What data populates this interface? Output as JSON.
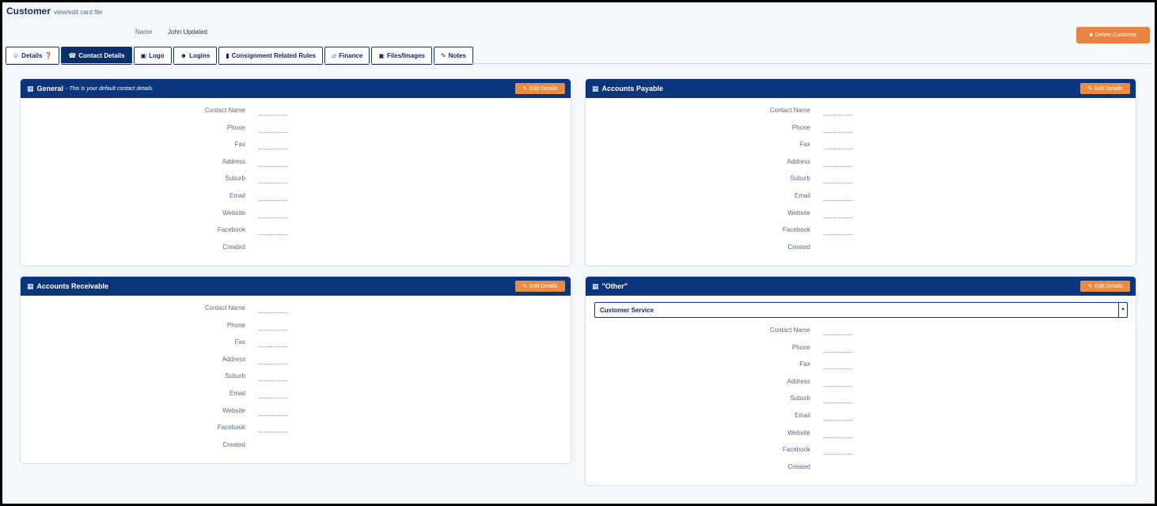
{
  "header": {
    "title": "Customer",
    "subtitle": "view/edit card file",
    "name_label": "Name",
    "name_value": "John Updated",
    "delete_label": "Delete Customer"
  },
  "tabs": [
    {
      "label": "Details",
      "icon": "user-icon",
      "glyph": "☺"
    },
    {
      "label": "Contact Details",
      "icon": "phone-icon",
      "glyph": "☎"
    },
    {
      "label": "Logo",
      "icon": "image-icon",
      "glyph": "▣"
    },
    {
      "label": "Logins",
      "icon": "users-icon",
      "glyph": "☻"
    },
    {
      "label": "Consignment Related Rules",
      "icon": "file-icon",
      "glyph": "▮"
    },
    {
      "label": "Finance",
      "icon": "folder-open-icon",
      "glyph": "▱"
    },
    {
      "label": "Files/Images",
      "icon": "file-image-icon",
      "glyph": "▣"
    },
    {
      "label": "Notes",
      "icon": "pencil-icon",
      "glyph": "✎"
    }
  ],
  "active_tab": "Contact Details",
  "colors": {
    "header_navy": "#0b357a",
    "accent_orange": "#ec8a3f",
    "page_bg": "#f4f7fc"
  },
  "field_labels": [
    "Contact Name",
    "Phone",
    "Fax",
    "Address",
    "Suburb",
    "Email",
    "Website",
    "Facebook",
    "Created"
  ],
  "empty_value": "------------",
  "panels": {
    "general": {
      "title": "General",
      "subtitle": "- This is your default contact details",
      "edit_label": "Edit Details"
    },
    "payable": {
      "title": "Accounts Payable",
      "edit_label": "Edit Details"
    },
    "receivable": {
      "title": "Accounts Receivable",
      "edit_label": "Edit Details"
    },
    "other": {
      "title": "\"Other\"",
      "edit_label": "Edit Details",
      "select_value": "Customer Service"
    }
  }
}
